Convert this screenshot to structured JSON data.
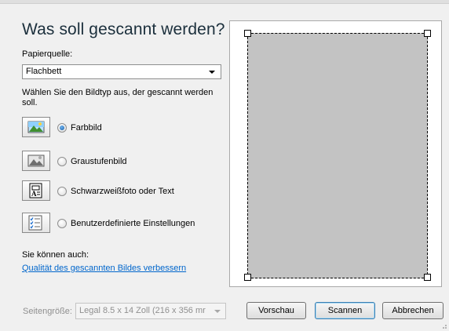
{
  "dialog": {
    "heading": "Was soll gescannt werden?",
    "paper_source_label": "Papierquelle:",
    "paper_source_value": "Flachbett",
    "image_type_prompt": "Wählen Sie den Bildtyp aus, der gescannt werden soll.",
    "options": [
      {
        "label": "Farbbild",
        "selected": true,
        "icon": "color-photo-icon"
      },
      {
        "label": "Graustufenbild",
        "selected": false,
        "icon": "grayscale-photo-icon"
      },
      {
        "label": "Schwarzweißfoto oder Text",
        "selected": false,
        "icon": "black-white-text-icon"
      },
      {
        "label": "Benutzerdefinierte Einstellungen",
        "selected": false,
        "icon": "custom-settings-icon"
      }
    ],
    "also_label": "Sie können auch:",
    "improve_link": "Qualität des gescannten Bildes verbessern",
    "page_size_label": "Seitengröße:",
    "page_size_value": "Legal 8.5 x 14 Zoll (216 x 356 mr",
    "buttons": {
      "preview": "Vorschau",
      "scan": "Scannen",
      "cancel": "Abbrechen"
    }
  },
  "colors": {
    "heading": "#1b2f3c",
    "link": "#0066cc",
    "scan_area": "#c3c3c3",
    "radio_selected": "#1a5fa8"
  }
}
